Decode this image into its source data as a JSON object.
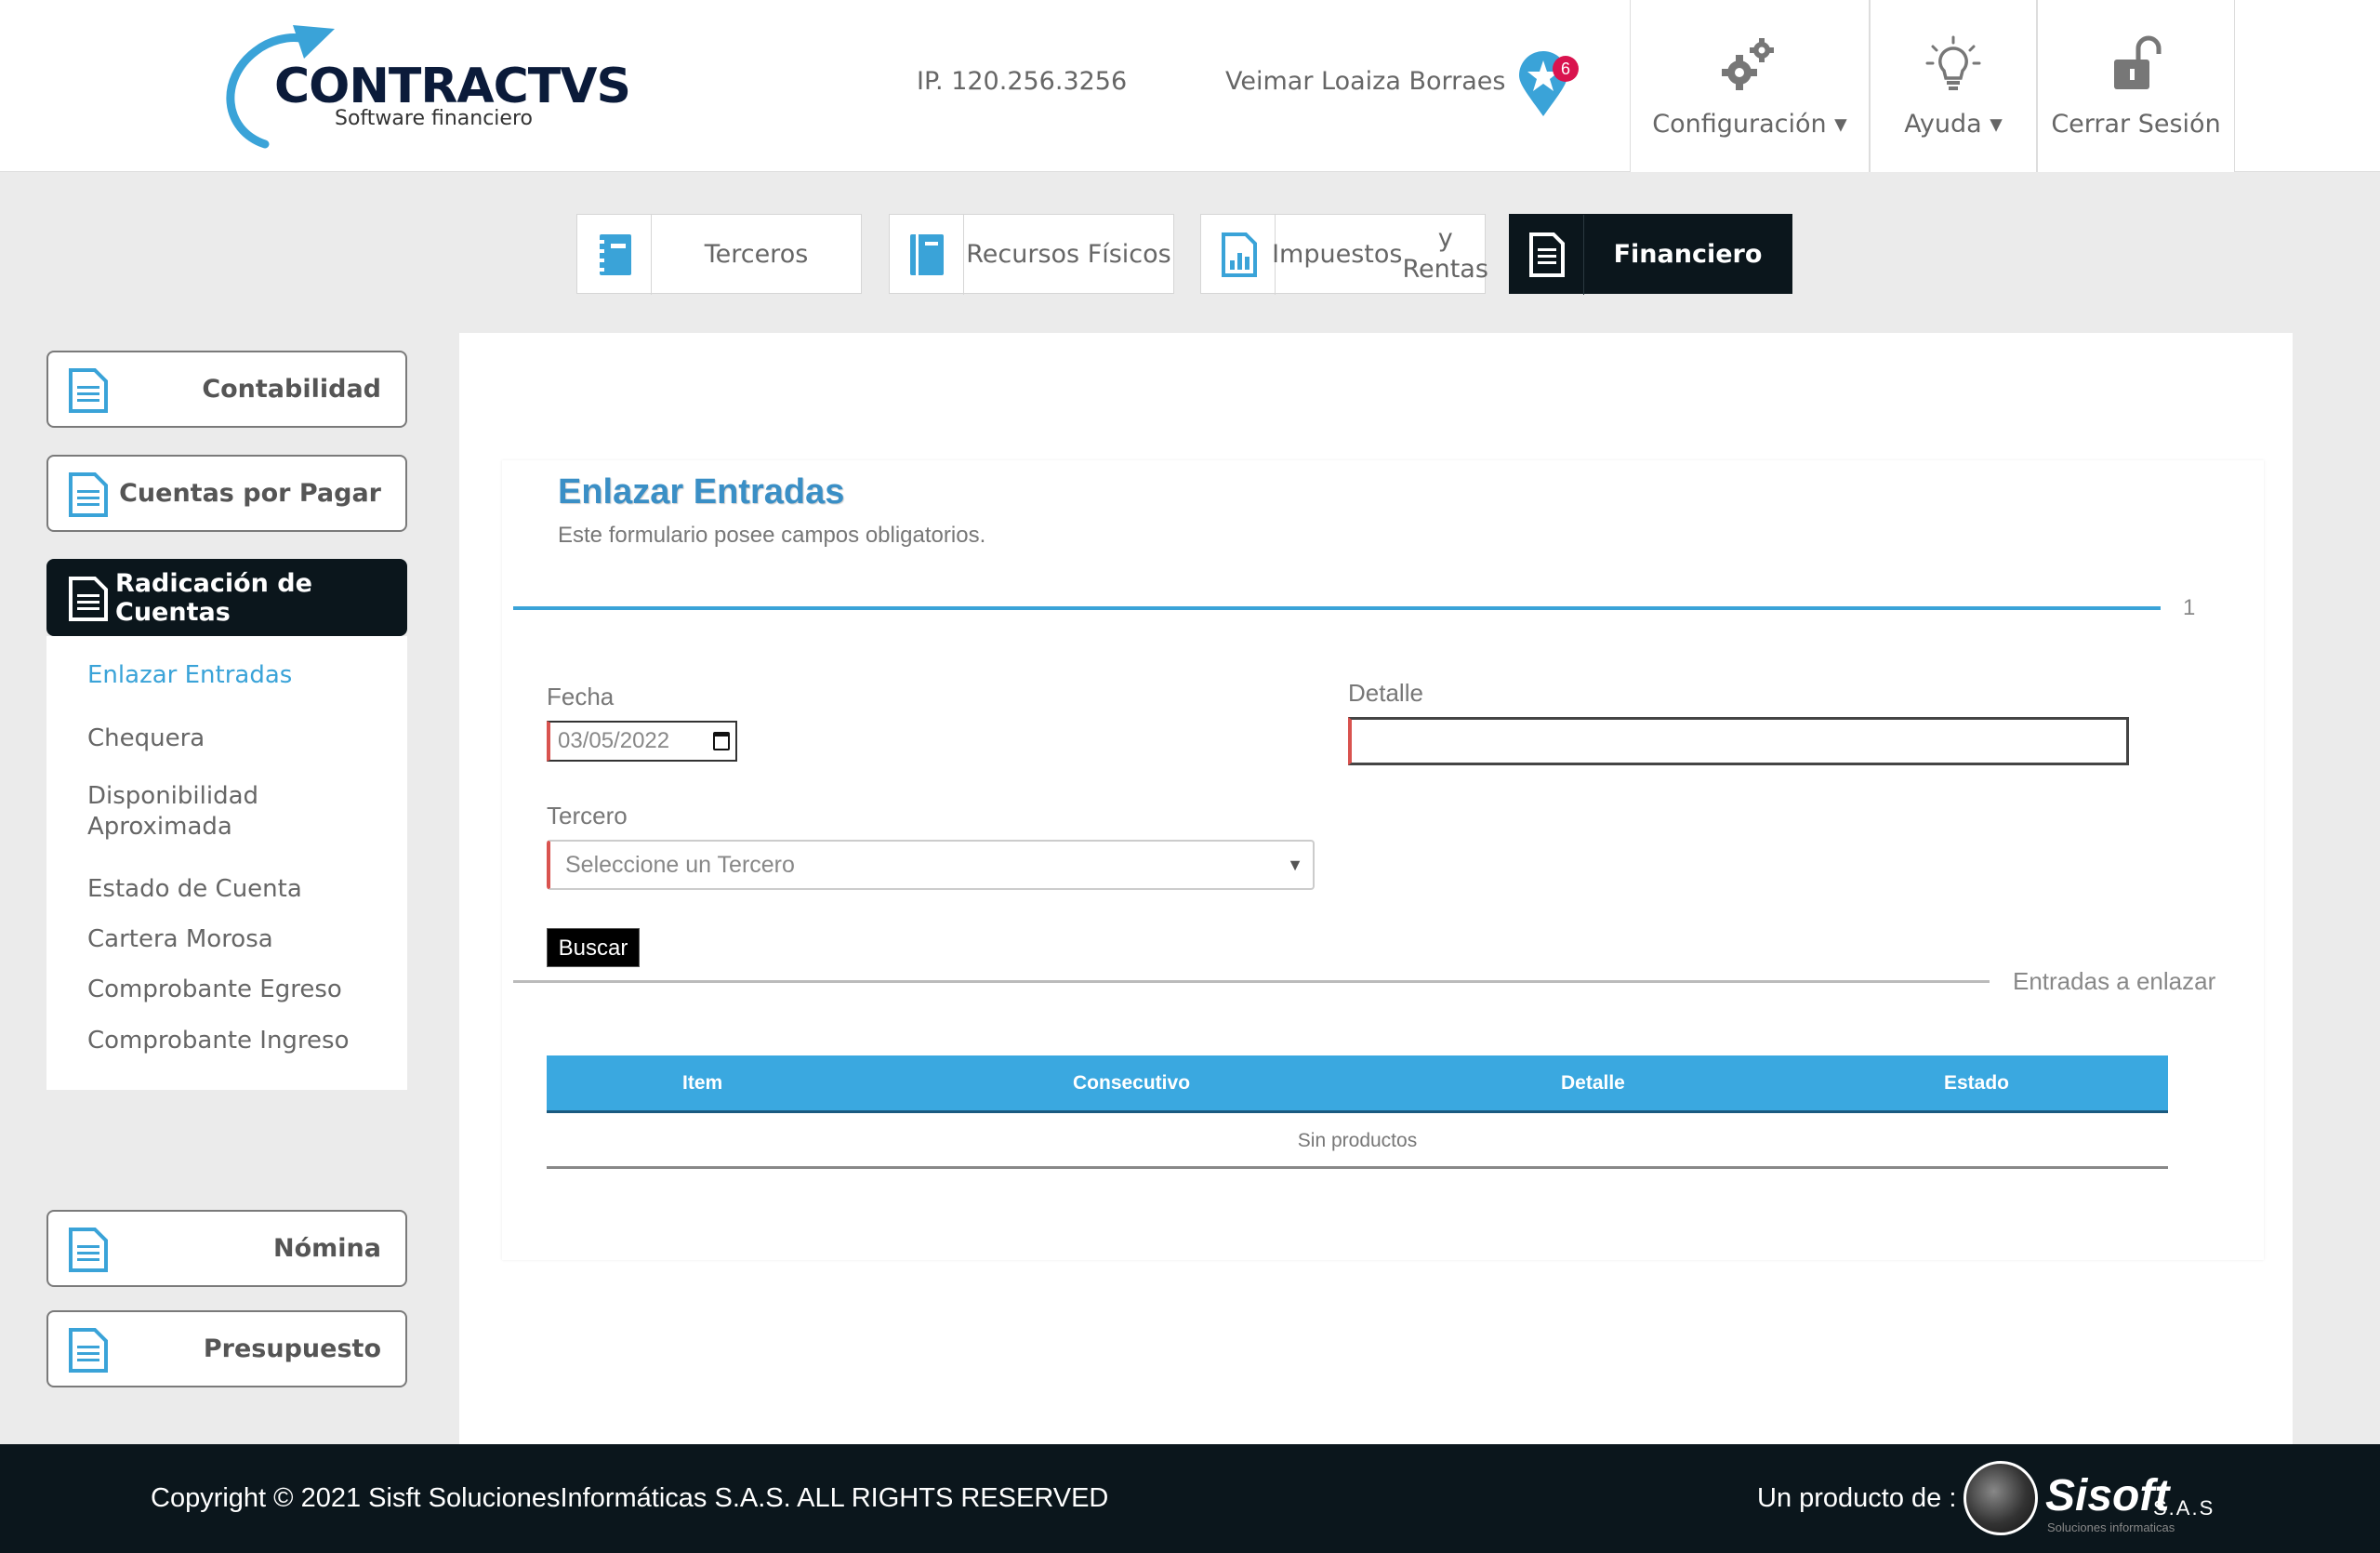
{
  "colors": {
    "accent": "#3aa3d8",
    "dark": "#0b161c",
    "required": "#d9534f",
    "badge": "#d9134e"
  },
  "brand": {
    "name": "CONTRACTVS",
    "tagline": "Software financiero"
  },
  "header": {
    "ip": "IP. 120.256.3256",
    "user": "Veimar Loaiza Borraes",
    "notifications": "6",
    "config_label": "Configuración ▾",
    "help_label": "Ayuda ▾",
    "logout_label": "Cerrar Sesión"
  },
  "modules": [
    {
      "label": "Terceros",
      "icon": "notebook-icon"
    },
    {
      "label": "Recursos Físicos",
      "icon": "book-icon"
    },
    {
      "label": "Impuestos y Rentas",
      "label_l1": "Impuestos",
      "label_l2": "y Rentas",
      "icon": "report-icon"
    },
    {
      "label": "Financiero",
      "icon": "document-icon",
      "active": true
    }
  ],
  "sidebar": {
    "contabilidad": "Contabilidad",
    "cuentas": "Cuentas por Pagar",
    "radicacion": "Radicación de Cuentas",
    "items": [
      "Enlazar Entradas",
      "Chequera",
      "Disponibilidad",
      "Aproximada",
      "Estado de Cuenta",
      "Cartera Morosa",
      "Comprobante Egreso",
      "Comprobante Ingreso"
    ],
    "nomina": "Nómina",
    "presupuesto": "Presupuesto"
  },
  "form": {
    "title": "Enlazar Entradas",
    "subtitle": "Este formulario posee campos obligatorios.",
    "step": "1",
    "fecha_label": "Fecha",
    "fecha_value": "03/05/2022",
    "detalle_label": "Detalle",
    "detalle_value": "",
    "tercero_label": "Tercero",
    "tercero_placeholder": "Seleccione un Tercero",
    "buscar": "Buscar",
    "section_title": "Entradas a enlazar",
    "table": {
      "columns": [
        "Item",
        "Consecutivo",
        "Detalle",
        "Estado"
      ],
      "empty": "Sin productos"
    }
  },
  "footer": {
    "copyright": "Copyright © 2021 Sisft SolucionesInformáticas S.A.S. ALL RIGHTS RESERVED",
    "product_of": "Un producto de :",
    "sisoft": "Sisoft",
    "sas": "S.A.S",
    "sisoft_tag": "Soluciones informaticas"
  }
}
